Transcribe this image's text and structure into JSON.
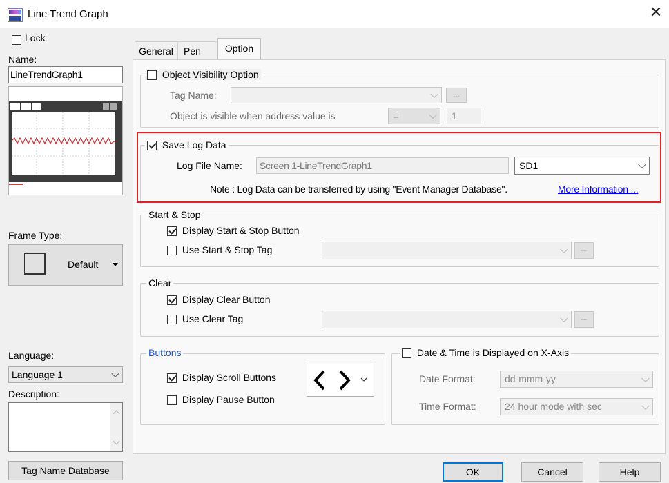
{
  "window": {
    "title": "Line Trend Graph"
  },
  "left": {
    "lock_label": "Lock",
    "name_label": "Name:",
    "name_value": "LineTrendGraph1",
    "frame_type_label": "Frame Type:",
    "frame_type_value": "Default",
    "language_label": "Language:",
    "language_value": "Language 1",
    "description_label": "Description:",
    "tag_db_button": "Tag Name Database"
  },
  "tabs": [
    {
      "label": "General"
    },
    {
      "label": "Pen"
    },
    {
      "label": "Option"
    }
  ],
  "visibility": {
    "checkbox_label": "Object Visibility Option",
    "tag_name_label": "Tag Name:",
    "condition_label": "Object is visible when address value is",
    "operator": "=",
    "value": "1",
    "ellipsis": "..."
  },
  "save_log": {
    "checkbox_label": "Save Log Data",
    "file_name_label": "Log File Name:",
    "file_name_value": "Screen 1-LineTrendGraph1",
    "device_value": "SD1",
    "note": "Note : Log Data can be transferred by using \"Event Manager Database\".",
    "more_info": "More Information ...",
    "highlight_color": "#e0202a"
  },
  "start_stop": {
    "title": "Start & Stop",
    "display_button_label": "Display Start & Stop Button",
    "use_tag_label": "Use Start & Stop Tag",
    "ellipsis": "..."
  },
  "clear": {
    "title": "Clear",
    "display_button_label": "Display Clear Button",
    "use_tag_label": "Use Clear Tag",
    "ellipsis": "..."
  },
  "buttons": {
    "title": "Buttons",
    "scroll_label": "Display Scroll Buttons",
    "pause_label": "Display Pause Button",
    "scroll_icon": "chevron-left-right-icon"
  },
  "datetime": {
    "checkbox_label": "Date & Time is Displayed on X-Axis",
    "date_format_label": "Date Format:",
    "date_format_value": "dd-mmm-yy",
    "time_format_label": "Time Format:",
    "time_format_value": "24 hour mode with sec"
  },
  "footer": {
    "ok": "OK",
    "cancel": "Cancel",
    "help": "Help"
  },
  "colors": {
    "link": "#0000ee",
    "group_title_blue": "#1a56c4",
    "default_button_border": "#0078d7"
  }
}
